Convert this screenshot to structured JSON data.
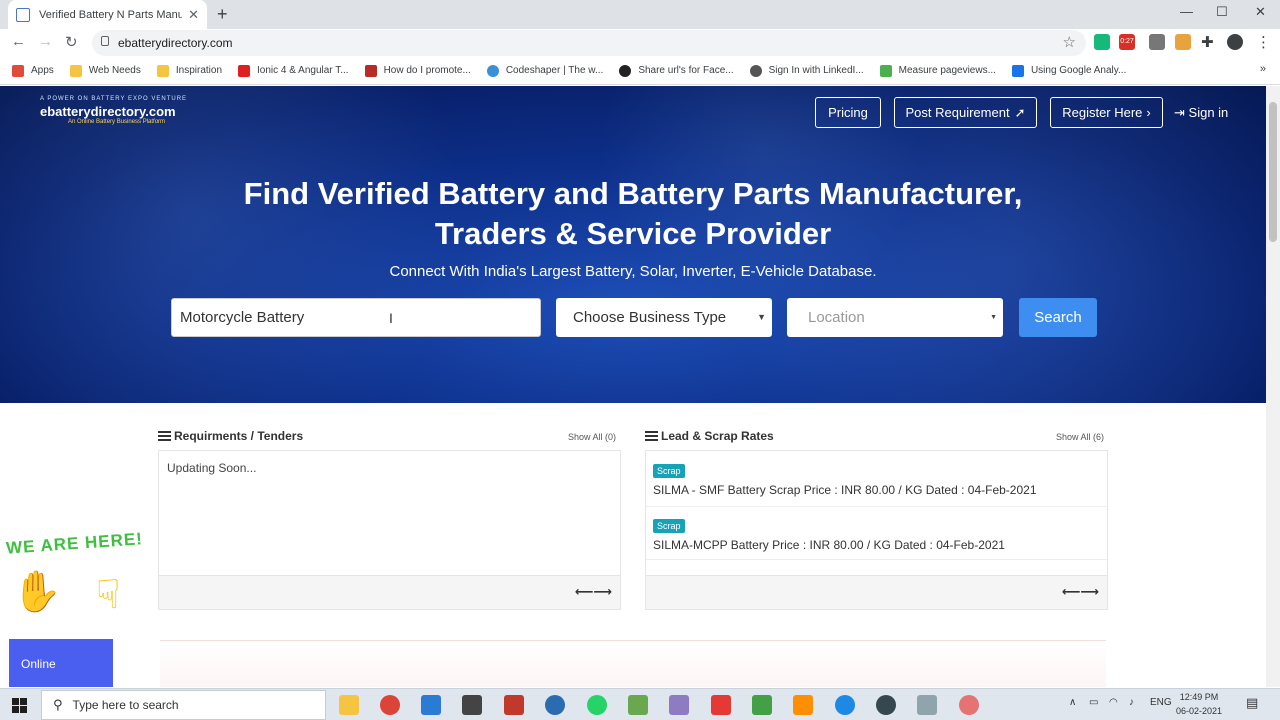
{
  "browser": {
    "tab_title": "Verified Battery N Parts Manufac",
    "url": "ebatterydirectory.com",
    "bookmarks": [
      {
        "label": "Apps",
        "color": "#e04a3a"
      },
      {
        "label": "Web Needs",
        "color": "#f5c542"
      },
      {
        "label": "Inspiration",
        "color": "#f5c542"
      },
      {
        "label": "Ionic 4 & Angular T...",
        "color": "#e02020"
      },
      {
        "label": "How do I promote...",
        "color": "#b92b27"
      },
      {
        "label": "Codeshaper | The w...",
        "color": "#3a8fd9"
      },
      {
        "label": "Share url's for Face...",
        "color": "#222222"
      },
      {
        "label": "Sign In with LinkedI...",
        "color": "#555555"
      },
      {
        "label": "Measure pageviews...",
        "color": "#4caf50"
      },
      {
        "label": "Using Google Analy...",
        "color": "#1a73e8"
      }
    ],
    "badge_count": "0:27"
  },
  "hero": {
    "logo_tagline": "A POWER ON BATTERY EXPO VENTURE",
    "logo_main": "ebatterydirectory.com",
    "logo_sub": "An Online Battery Business Platform",
    "nav": {
      "pricing": "Pricing",
      "post": "Post Requirement",
      "register": "Register Here",
      "signin": "Sign in"
    },
    "title_line1": "Find Verified Battery and Battery Parts Manufacturer,",
    "title_line2": "Traders & Service Provider",
    "tagline": "Connect With India's Largest Battery, Solar, Inverter, E-Vehicle Database.",
    "search_value": "Motorcycle Battery",
    "business_type": "Choose Business Type",
    "location_placeholder": "Location",
    "search_button": "Search"
  },
  "requirements": {
    "title": "Requirments / Tenders",
    "show_all": "Show All (0)",
    "empty_text": "Updating Soon..."
  },
  "rates": {
    "title": "Lead & Scrap Rates",
    "show_all": "Show All (6)",
    "items": [
      {
        "badge": "Scrap",
        "text": "SILMA - SMF Battery Scrap Price : INR 80.00 / KG Dated : 04-Feb-2021"
      },
      {
        "badge": "Scrap",
        "text": "SILMA-MCPP Battery Price : INR 80.00 / KG Dated : 04-Feb-2021"
      }
    ]
  },
  "widget": {
    "headline": "WE ARE HERE!",
    "status": "Online"
  },
  "taskbar": {
    "search_placeholder": "Type here to search",
    "lang": "ENG",
    "time": "12:49 PM",
    "date": "06-02-2021"
  }
}
